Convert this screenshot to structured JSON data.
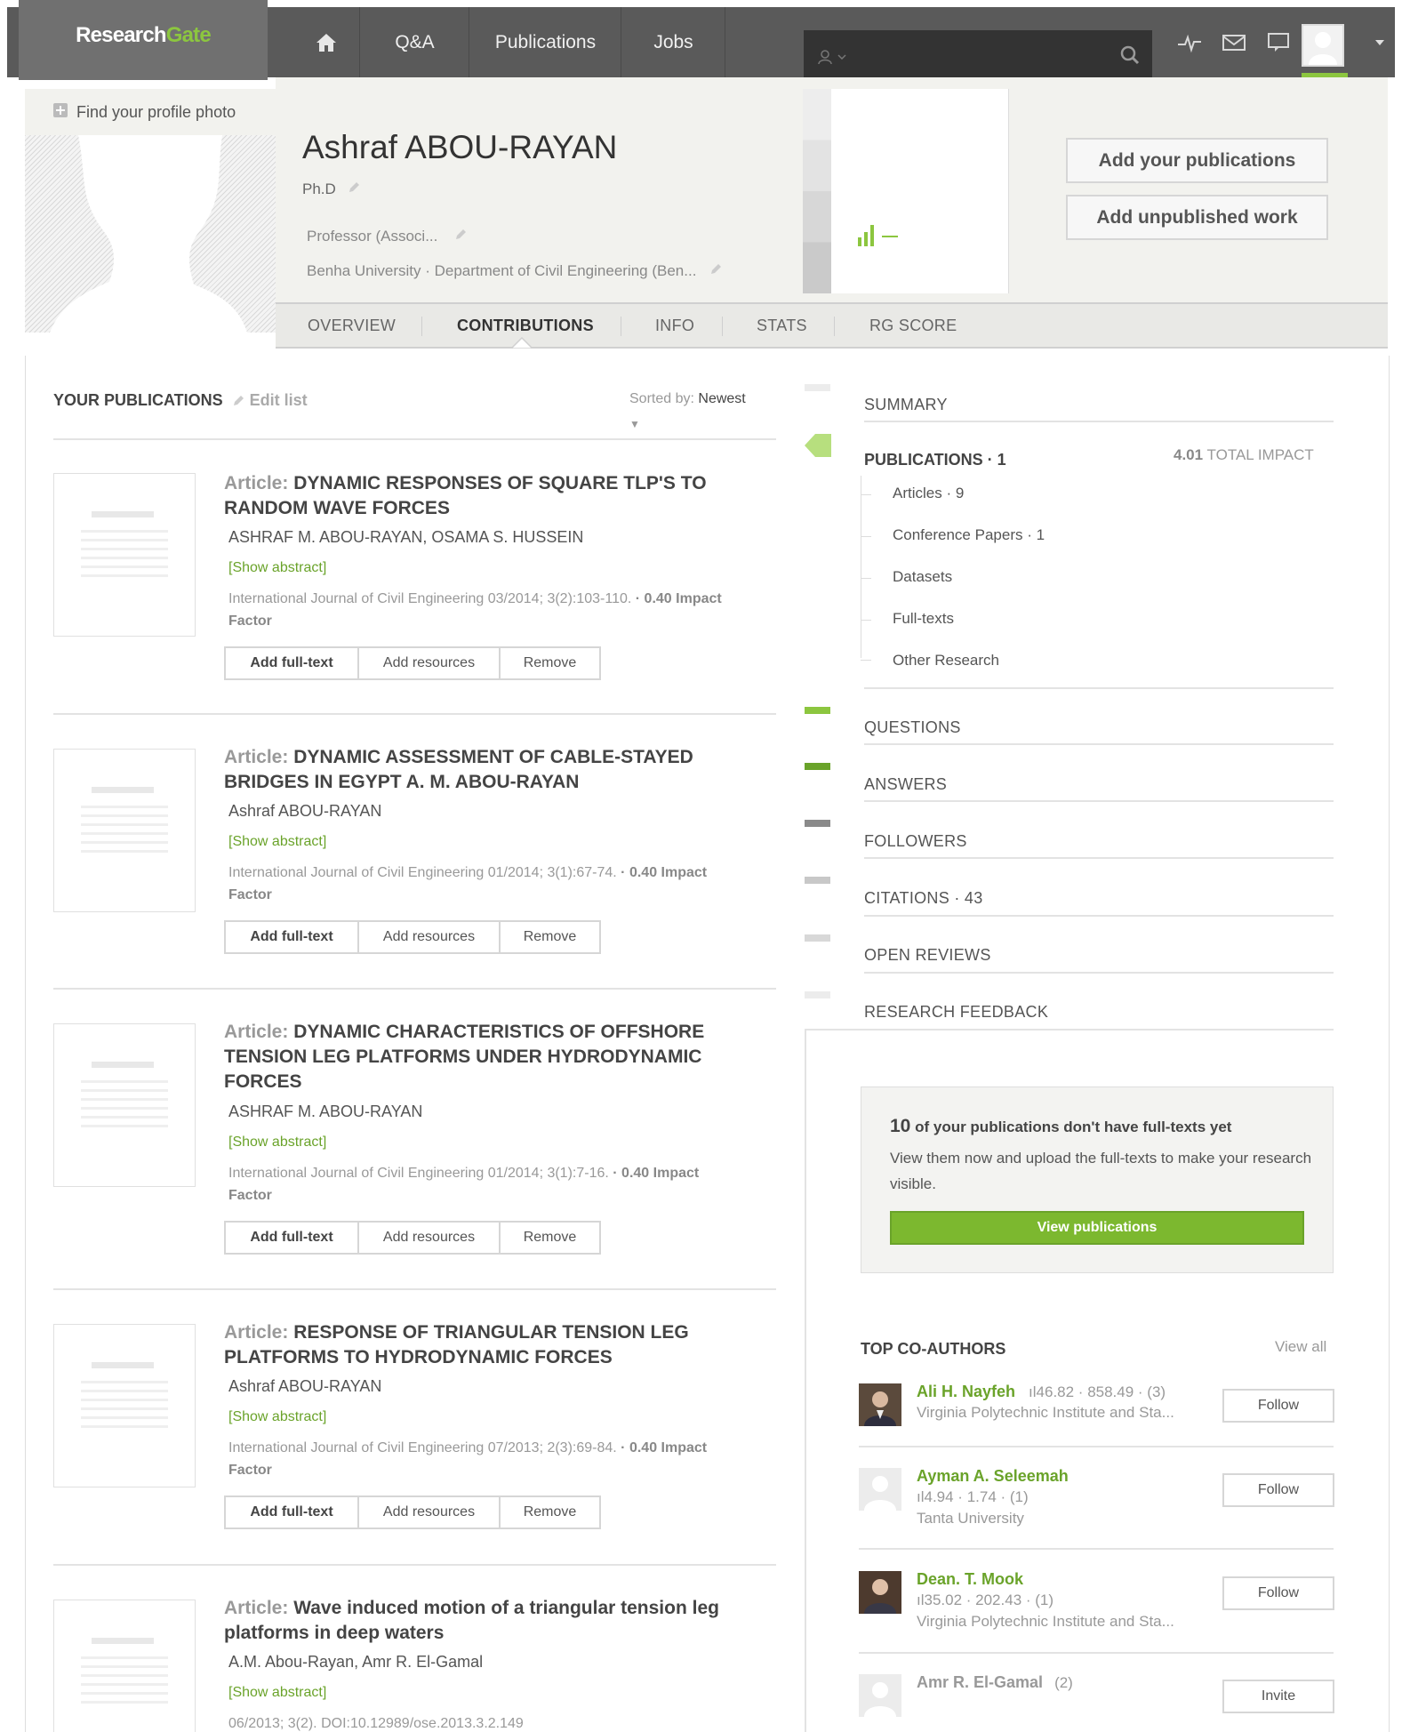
{
  "header": {
    "logo_part1": "Research",
    "logo_part2": "Gate",
    "nav": [
      "Q&A",
      "Publications",
      "Jobs"
    ]
  },
  "profile": {
    "find_photo": "Find your profile photo",
    "name": "Ashraf ABOU-RAYAN",
    "degree": "Ph.D",
    "position": "Professor (Associ...",
    "affiliation": "Benha University · Department of Civil Engineering (Ben...",
    "add_publications": "Add your publications",
    "add_unpublished": "Add unpublished work"
  },
  "tabs": [
    "OVERVIEW",
    "CONTRIBUTIONS",
    "INFO",
    "STATS",
    "RG SCORE"
  ],
  "publications": {
    "header": "YOUR PUBLICATIONS",
    "edit_list": "Edit list",
    "sorted_label": "Sorted by:",
    "sorted_value": "Newest",
    "items": [
      {
        "kind": "Article:",
        "title": "DYNAMIC RESPONSES OF SQUARE TLP'S TO RANDOM WAVE FORCES",
        "authors": "ASHRAF M. ABOU-RAYAN, OSAMA S. HUSSEIN",
        "abstract": "[Show abstract]",
        "journal": "International Journal of Civil Engineering 03/2014; 3(2):103-110.",
        "impact": "· 0.40 Impact Factor"
      },
      {
        "kind": "Article:",
        "title": "DYNAMIC ASSESSMENT OF CABLE-STAYED BRIDGES IN EGYPT A. M. ABOU-RAYAN",
        "authors": "Ashraf ABOU-RAYAN",
        "abstract": "[Show abstract]",
        "journal": "International Journal of Civil Engineering 01/2014; 3(1):67-74.",
        "impact": "· 0.40 Impact Factor"
      },
      {
        "kind": "Article:",
        "title": "DYNAMIC CHARACTERISTICS OF OFFSHORE TENSION LEG PLATFORMS UNDER HYDRODYNAMIC FORCES",
        "authors": "ASHRAF M. ABOU-RAYAN",
        "abstract": "[Show abstract]",
        "journal": "International Journal of Civil Engineering 01/2014; 3(1):7-16.",
        "impact": "· 0.40 Impact Factor"
      },
      {
        "kind": "Article:",
        "title": "RESPONSE OF TRIANGULAR TENSION LEG PLATFORMS TO HYDRODYNAMIC FORCES",
        "authors": "Ashraf ABOU-RAYAN",
        "abstract": "[Show abstract]",
        "journal": "International Journal of Civil Engineering 07/2013; 2(3):69-84.",
        "impact": "· 0.40 Impact Factor"
      },
      {
        "kind": "Article:",
        "title": "Wave induced motion of a triangular tension leg platforms in deep waters",
        "authors": "A.M. Abou-Rayan, Amr R. El-Gamal",
        "abstract": "[Show abstract]",
        "journal": "06/2013; 3(2). DOI:10.12989/ose.2013.3.2.149",
        "impact": ""
      }
    ],
    "btn_add_fulltext": "Add full-text",
    "btn_add_resources": "Add resources",
    "btn_remove": "Remove"
  },
  "sidebar": {
    "summary": "SUMMARY",
    "publications_title": "PUBLICATIONS · 1",
    "total_impact_value": "4.01",
    "total_impact_label": "TOTAL IMPACT",
    "sub_items": [
      "Articles · 9",
      "Conference Papers · 1",
      "Datasets",
      "Full-texts",
      "Other Research"
    ],
    "sections": [
      "QUESTIONS",
      "ANSWERS",
      "FOLLOWERS",
      "CITATIONS · 43",
      "OPEN REVIEWS",
      "RESEARCH FEEDBACK"
    ]
  },
  "promo": {
    "count": "10",
    "title": "of your publications don't have full-texts yet",
    "text": "View them now and upload the full-texts to make your research visible.",
    "button": "View publications"
  },
  "coauthors": {
    "title": "TOP CO-AUTHORS",
    "view_all": "View all",
    "items": [
      {
        "name": "Ali H. Nayfeh",
        "stats": "46.82 · 858.49 · (3)",
        "meta": "Virginia Polytechnic Institute and Sta...",
        "button": "Follow"
      },
      {
        "name": "Ayman A. Seleemah",
        "stats": "4.94 · 1.74 · (1)",
        "meta": "Tanta University",
        "button": "Follow"
      },
      {
        "name": "Dean. T. Mook",
        "stats": "35.02 · 202.43 · (1)",
        "meta": "Virginia Polytechnic Institute and Sta...",
        "button": "Follow"
      },
      {
        "name": "Amr R. El-Gamal",
        "stats": "(2)",
        "meta": "",
        "button": "Invite"
      }
    ]
  },
  "colors": {
    "accent": "#8cc63f",
    "link_green": "#6aa32a",
    "topbar": "#5a5a5a"
  }
}
